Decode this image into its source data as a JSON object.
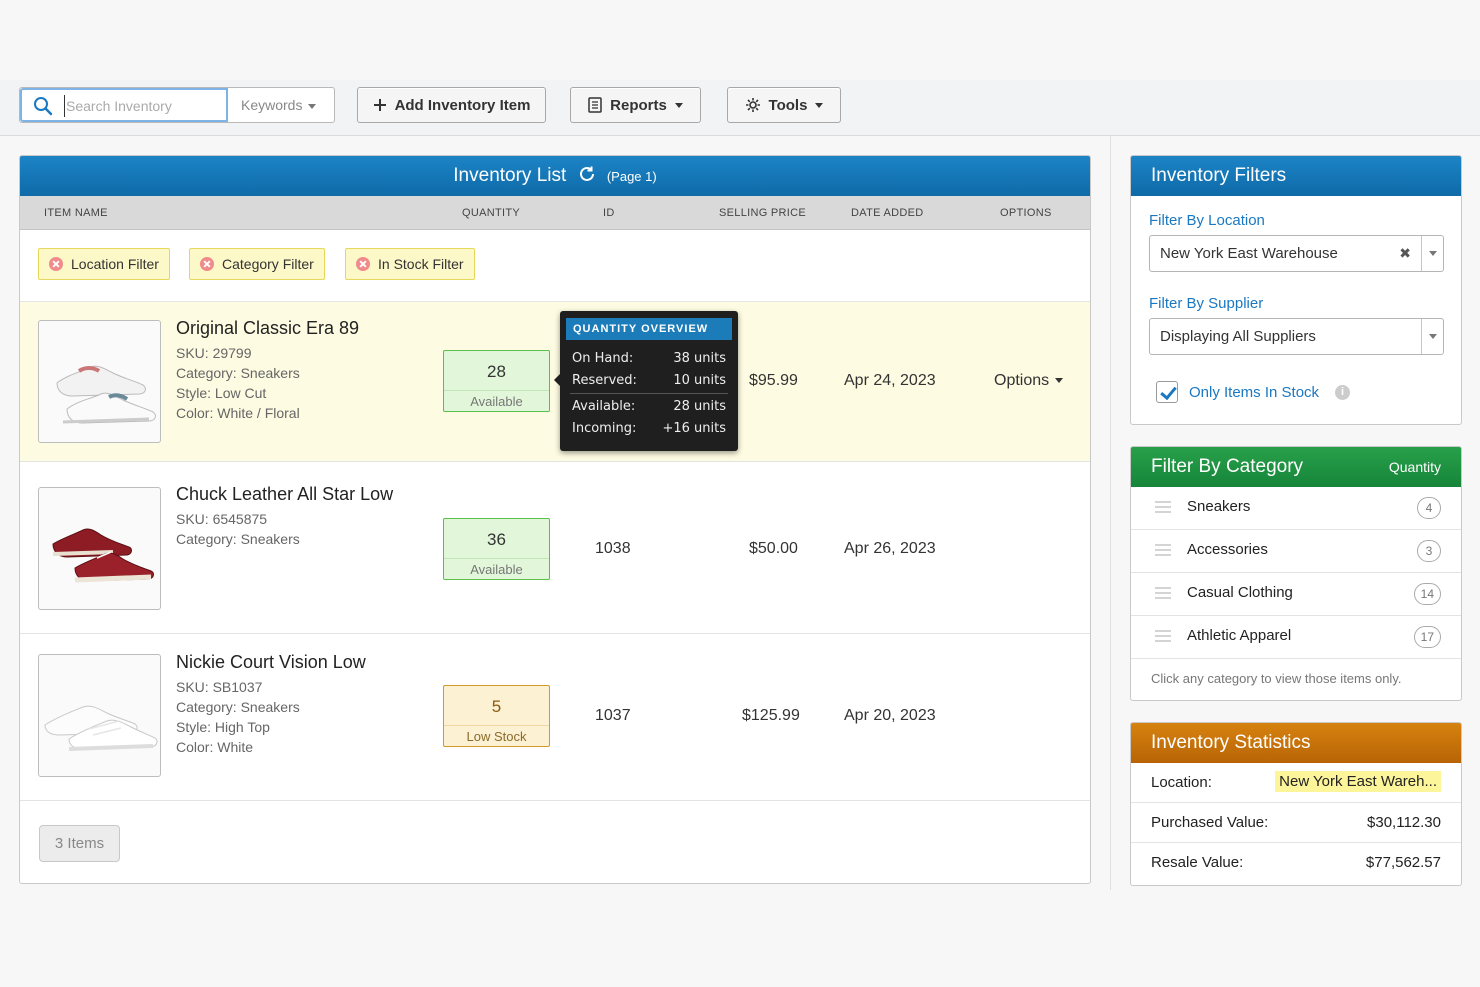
{
  "toolbar": {
    "search_placeholder": "Search Inventory",
    "keywords_label": "Keywords",
    "add_label": "Add Inventory Item",
    "reports_label": "Reports",
    "tools_label": "Tools"
  },
  "list": {
    "title": "Inventory List",
    "page": "(Page 1)",
    "columns": [
      "ITEM NAME",
      "QUANTITY",
      "ID",
      "SELLING PRICE",
      "DATE ADDED",
      "OPTIONS"
    ],
    "filters": [
      "Location Filter",
      "Category Filter",
      "In Stock Filter"
    ],
    "items": [
      {
        "name": "Original Classic Era 89",
        "meta": [
          "SKU: 29799",
          "Category: Sneakers",
          "Style: Low Cut",
          "Color: White / Floral"
        ],
        "qty": "28",
        "qty_label": "Available",
        "id": "",
        "price": "$95.99",
        "date": "Apr 24, 2023",
        "options": "Options"
      },
      {
        "name": "Chuck Leather All Star Low",
        "meta": [
          "SKU: 6545875",
          "Category: Sneakers"
        ],
        "qty": "36",
        "qty_label": "Available",
        "id": "1038",
        "price": "$50.00",
        "date": "Apr 26, 2023",
        "options": ""
      },
      {
        "name": "Nickie Court Vision Low",
        "meta": [
          "SKU: SB1037",
          "Category: Sneakers",
          "Style: High Top",
          "Color: White"
        ],
        "qty": "5",
        "qty_label": "Low Stock",
        "id": "1037",
        "price": "$125.99",
        "date": "Apr 20, 2023",
        "options": ""
      }
    ],
    "count_label": "3 Items"
  },
  "tooltip": {
    "title": "QUANTITY OVERVIEW",
    "on_hand_k": "On Hand:",
    "on_hand_v": "38 units",
    "reserved_k": "Reserved:",
    "reserved_v": "10 units",
    "available_k": "Available:",
    "available_v": "28 units",
    "incoming_k": "Incoming:",
    "incoming_v": "+16 units"
  },
  "filters_panel": {
    "title": "Inventory Filters",
    "location_label": "Filter By Location",
    "location_value": "New York East Warehouse",
    "supplier_label": "Filter By Supplier",
    "supplier_value": "Displaying All Suppliers",
    "in_stock_label": "Only Items In Stock"
  },
  "category_panel": {
    "title": "Filter By Category",
    "qty_header": "Quantity",
    "categories": [
      {
        "name": "Sneakers",
        "count": "4"
      },
      {
        "name": "Accessories",
        "count": "3"
      },
      {
        "name": "Casual Clothing",
        "count": "14"
      },
      {
        "name": "Athletic Apparel",
        "count": "17"
      }
    ],
    "hint": "Click any category to view those items only."
  },
  "stats_panel": {
    "title": "Inventory Statistics",
    "location_k": "Location:",
    "location_v": "New York East Wareh...",
    "purchased_k": "Purchased Value:",
    "purchased_v": "$30,112.30",
    "resale_k": "Resale Value:",
    "resale_v": "$77,562.57"
  },
  "colors": {
    "header_blue": "#1c84c6",
    "category_green": "#28a04a",
    "stats_orange": "#d6820f",
    "highlight_row": "#fdfbe1",
    "chip_yellow": "#fdf8c8"
  }
}
